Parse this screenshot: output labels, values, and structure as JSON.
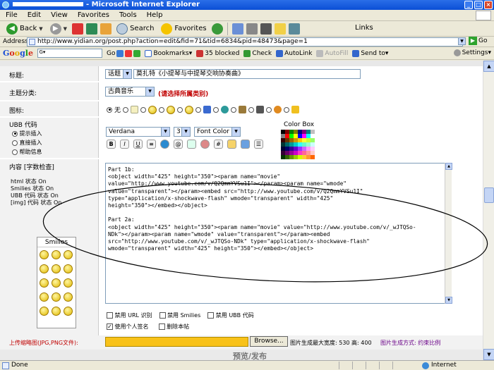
{
  "window": {
    "title": "- Microsoft Internet Explorer",
    "btn_min": "_",
    "btn_max": "□",
    "btn_close": "×"
  },
  "menu": [
    "File",
    "Edit",
    "View",
    "Favorites",
    "Tools",
    "Help"
  ],
  "toolbar": {
    "back": "Back",
    "search": "Search",
    "favorites": "Favorites",
    "links": "Links"
  },
  "address": {
    "label": "Address",
    "url": "http://www.yidian.org/post.php?action=edit&fid=71&tid=6834&pid=48473&page=1",
    "go": "Go"
  },
  "google_bar": {
    "logo": [
      "G",
      "o",
      "o",
      "g",
      "l",
      "e"
    ],
    "go": "Go",
    "bookmarks": "Bookmarks▾",
    "blocked": "35 blocked",
    "check": "Check",
    "autolink": "AutoLink",
    "autofill": "AutoFill",
    "sendto": "Send to▾",
    "settings": "Settings▾"
  },
  "form": {
    "title_label": "标题:",
    "title_prefix": "话题",
    "title_value": "莫扎特《小提琴与中提琴交响协奏曲》",
    "category_label": "主题分类:",
    "category_value": "古典音乐",
    "category_hint": "(请选择所属类别)",
    "icon_label": "图标:",
    "icon_none": "无",
    "ubb_label": "UBB 代码",
    "ubb_modes": [
      "提示插入",
      "直接插入",
      "帮助信息"
    ],
    "font_face": "Verdana",
    "font_size": "3",
    "font_color": "Font Color",
    "color_box": "Color Box",
    "content_label": "内容",
    "content_check": "[字数检查]",
    "status_html": "html 状态 On",
    "status_smilies": "Smilies 状态 On",
    "status_ubb": "UBB 代码 状态 On",
    "status_img": "[img] 代码 状态 On",
    "smilies_title": "Smilies",
    "editor_text": "Part 1b:\n<object width=\"425\" height=\"350\"><param name=\"movie\"\nvalue=\"http://www.youtube.com/v/Q2QmmYVSu1I\"></param><param name=\"wmode\"\nvalue=\"transparent\"></param><embed src=\"http://www.youtube.com/v/Q2QmmYVSu1I\"\ntype=\"application/x-shockwave-flash\" wmode=\"transparent\" width=\"425\"\nheight=\"350\"></embed></object>\n\nPart 2a:\n<object width=\"425\" height=\"350\"><param name=\"movie\" value=\"http://www.youtube.com/v/_wJTQSo-\nNDk\"></param><param name=\"wmode\" value=\"transparent\"></param><embed\nsrc=\"http://www.youtube.com/v/_wJTQSo-NDk\" type=\"application/x-shockwave-flash\"\nwmode=\"transparent\" width=\"425\" height=\"350\"></embed></object>",
    "opt_url": "禁用 URL 识别",
    "opt_smilies": "禁用 Smilies",
    "opt_ubb": "禁用 UBB 代码",
    "opt_sig": "使用个人签名",
    "opt_delete": "删除本帖",
    "upload_label": "上传缩略图(JPG,PNG文件):",
    "browse": "Browse...",
    "upload_info_a": "图片生成最大宽度: 530  高: 400",
    "upload_info_b": "图片生成方式: 约束比例",
    "bottom_text": "预览/发布"
  },
  "statusbar": {
    "done": "Done",
    "zone": "Internet"
  },
  "colors": {
    "palette": [
      "#000000",
      "#800000",
      "#008000",
      "#808000",
      "#000080",
      "#800080",
      "#008080",
      "#c0c0c0",
      "#808080",
      "#ff0000",
      "#00ff00",
      "#ffff00",
      "#0000ff",
      "#ff00ff",
      "#00ffff",
      "#ffffff",
      "#330000",
      "#663300",
      "#996600",
      "#cc9900",
      "#ffcc00",
      "#ffff33",
      "#ccff33",
      "#99ff66",
      "#003333",
      "#006666",
      "#009999",
      "#00cccc",
      "#33ffff",
      "#66ffcc",
      "#99ffcc",
      "#ccffff",
      "#000033",
      "#000066",
      "#330099",
      "#6600cc",
      "#9933ff",
      "#cc66ff",
      "#ff99ff",
      "#ffccff",
      "#330033",
      "#660066",
      "#990099",
      "#cc00cc",
      "#ff33cc",
      "#ff6699",
      "#ff9999",
      "#ffcccc",
      "#003300",
      "#336600",
      "#669900",
      "#99cc00",
      "#ccff00",
      "#ffcc33",
      "#ff9933",
      "#ff6600"
    ]
  }
}
